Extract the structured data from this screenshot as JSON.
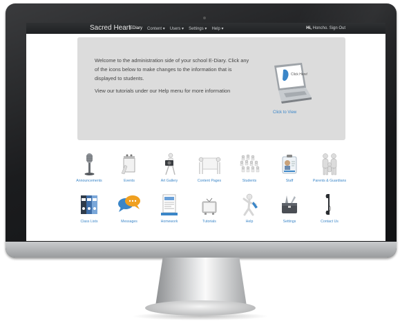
{
  "navbar": {
    "brand": "Sacred Heart",
    "items": [
      {
        "label": "EDiary"
      },
      {
        "label": "Content ▾"
      },
      {
        "label": "Users ▾"
      },
      {
        "label": "Settings ▾"
      },
      {
        "label": "Help ▾"
      }
    ],
    "greeting": "Hi,",
    "user_name": "Honcho.",
    "sign_out": "Sign Out"
  },
  "welcome": {
    "message": "Welcome to the administration side of your school E-Diary. Click any of the icons below to make changes to the information that is displayed to students.",
    "tutorial_note": "View our tutorials under our Help menu for more information",
    "laptop_screen_text": "Click Here!",
    "click_link": "Click to View"
  },
  "icons": {
    "row1": [
      {
        "label": "Announcements",
        "icon": "microphone-icon"
      },
      {
        "label": "Events",
        "icon": "calendar-icon"
      },
      {
        "label": "Art Gallery",
        "icon": "camera-icon"
      },
      {
        "label": "Content Pages",
        "icon": "people-carrying-board-icon"
      },
      {
        "label": "Students",
        "icon": "students-icon"
      },
      {
        "label": "Staff",
        "icon": "id-badge-icon"
      },
      {
        "label": "Parents & Guardians",
        "icon": "family-icon"
      }
    ],
    "row2": [
      {
        "label": "Class Lists",
        "icon": "binders-icon"
      },
      {
        "label": "Messages",
        "icon": "speech-bubbles-icon"
      },
      {
        "label": "Homework",
        "icon": "document-icon"
      },
      {
        "label": "Tutorials",
        "icon": "tv-icon"
      },
      {
        "label": "Help",
        "icon": "help-figure-icon"
      },
      {
        "label": "Settings",
        "icon": "toolbox-icon"
      },
      {
        "label": "Contact Us",
        "icon": "phone-icon"
      }
    ]
  },
  "colors": {
    "navbar": "#1e2022",
    "panel": "#dcdcdc",
    "link": "#3b86c8",
    "bezel": "#1b1c1e"
  }
}
